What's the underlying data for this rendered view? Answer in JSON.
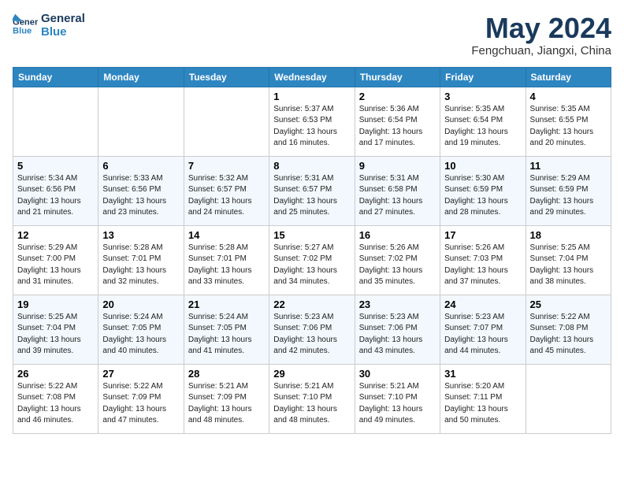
{
  "header": {
    "logo_line1": "General",
    "logo_line2": "Blue",
    "month": "May 2024",
    "location": "Fengchuan, Jiangxi, China"
  },
  "days_of_week": [
    "Sunday",
    "Monday",
    "Tuesday",
    "Wednesday",
    "Thursday",
    "Friday",
    "Saturday"
  ],
  "weeks": [
    [
      {
        "day": "",
        "data": ""
      },
      {
        "day": "",
        "data": ""
      },
      {
        "day": "",
        "data": ""
      },
      {
        "day": "1",
        "data": "Sunrise: 5:37 AM\nSunset: 6:53 PM\nDaylight: 13 hours and 16 minutes."
      },
      {
        "day": "2",
        "data": "Sunrise: 5:36 AM\nSunset: 6:54 PM\nDaylight: 13 hours and 17 minutes."
      },
      {
        "day": "3",
        "data": "Sunrise: 5:35 AM\nSunset: 6:54 PM\nDaylight: 13 hours and 19 minutes."
      },
      {
        "day": "4",
        "data": "Sunrise: 5:35 AM\nSunset: 6:55 PM\nDaylight: 13 hours and 20 minutes."
      }
    ],
    [
      {
        "day": "5",
        "data": "Sunrise: 5:34 AM\nSunset: 6:56 PM\nDaylight: 13 hours and 21 minutes."
      },
      {
        "day": "6",
        "data": "Sunrise: 5:33 AM\nSunset: 6:56 PM\nDaylight: 13 hours and 23 minutes."
      },
      {
        "day": "7",
        "data": "Sunrise: 5:32 AM\nSunset: 6:57 PM\nDaylight: 13 hours and 24 minutes."
      },
      {
        "day": "8",
        "data": "Sunrise: 5:31 AM\nSunset: 6:57 PM\nDaylight: 13 hours and 25 minutes."
      },
      {
        "day": "9",
        "data": "Sunrise: 5:31 AM\nSunset: 6:58 PM\nDaylight: 13 hours and 27 minutes."
      },
      {
        "day": "10",
        "data": "Sunrise: 5:30 AM\nSunset: 6:59 PM\nDaylight: 13 hours and 28 minutes."
      },
      {
        "day": "11",
        "data": "Sunrise: 5:29 AM\nSunset: 6:59 PM\nDaylight: 13 hours and 29 minutes."
      }
    ],
    [
      {
        "day": "12",
        "data": "Sunrise: 5:29 AM\nSunset: 7:00 PM\nDaylight: 13 hours and 31 minutes."
      },
      {
        "day": "13",
        "data": "Sunrise: 5:28 AM\nSunset: 7:01 PM\nDaylight: 13 hours and 32 minutes."
      },
      {
        "day": "14",
        "data": "Sunrise: 5:28 AM\nSunset: 7:01 PM\nDaylight: 13 hours and 33 minutes."
      },
      {
        "day": "15",
        "data": "Sunrise: 5:27 AM\nSunset: 7:02 PM\nDaylight: 13 hours and 34 minutes."
      },
      {
        "day": "16",
        "data": "Sunrise: 5:26 AM\nSunset: 7:02 PM\nDaylight: 13 hours and 35 minutes."
      },
      {
        "day": "17",
        "data": "Sunrise: 5:26 AM\nSunset: 7:03 PM\nDaylight: 13 hours and 37 minutes."
      },
      {
        "day": "18",
        "data": "Sunrise: 5:25 AM\nSunset: 7:04 PM\nDaylight: 13 hours and 38 minutes."
      }
    ],
    [
      {
        "day": "19",
        "data": "Sunrise: 5:25 AM\nSunset: 7:04 PM\nDaylight: 13 hours and 39 minutes."
      },
      {
        "day": "20",
        "data": "Sunrise: 5:24 AM\nSunset: 7:05 PM\nDaylight: 13 hours and 40 minutes."
      },
      {
        "day": "21",
        "data": "Sunrise: 5:24 AM\nSunset: 7:05 PM\nDaylight: 13 hours and 41 minutes."
      },
      {
        "day": "22",
        "data": "Sunrise: 5:23 AM\nSunset: 7:06 PM\nDaylight: 13 hours and 42 minutes."
      },
      {
        "day": "23",
        "data": "Sunrise: 5:23 AM\nSunset: 7:06 PM\nDaylight: 13 hours and 43 minutes."
      },
      {
        "day": "24",
        "data": "Sunrise: 5:23 AM\nSunset: 7:07 PM\nDaylight: 13 hours and 44 minutes."
      },
      {
        "day": "25",
        "data": "Sunrise: 5:22 AM\nSunset: 7:08 PM\nDaylight: 13 hours and 45 minutes."
      }
    ],
    [
      {
        "day": "26",
        "data": "Sunrise: 5:22 AM\nSunset: 7:08 PM\nDaylight: 13 hours and 46 minutes."
      },
      {
        "day": "27",
        "data": "Sunrise: 5:22 AM\nSunset: 7:09 PM\nDaylight: 13 hours and 47 minutes."
      },
      {
        "day": "28",
        "data": "Sunrise: 5:21 AM\nSunset: 7:09 PM\nDaylight: 13 hours and 48 minutes."
      },
      {
        "day": "29",
        "data": "Sunrise: 5:21 AM\nSunset: 7:10 PM\nDaylight: 13 hours and 48 minutes."
      },
      {
        "day": "30",
        "data": "Sunrise: 5:21 AM\nSunset: 7:10 PM\nDaylight: 13 hours and 49 minutes."
      },
      {
        "day": "31",
        "data": "Sunrise: 5:20 AM\nSunset: 7:11 PM\nDaylight: 13 hours and 50 minutes."
      },
      {
        "day": "",
        "data": ""
      }
    ]
  ]
}
